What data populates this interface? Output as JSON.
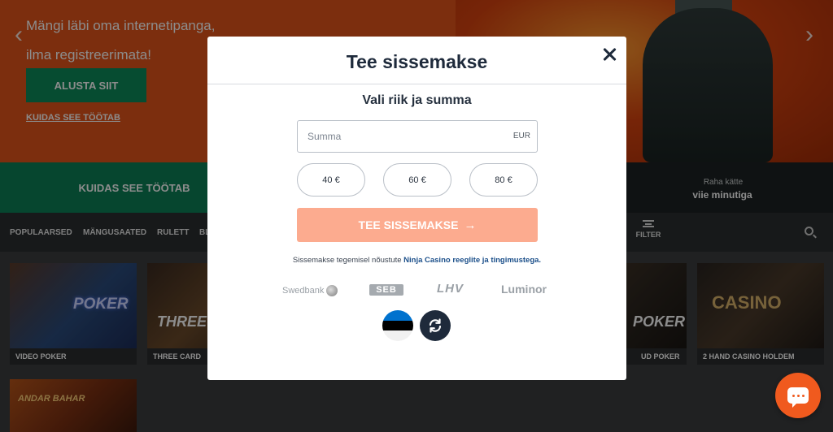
{
  "hero": {
    "text_line1": "Mängi läbi oma internetipanga,",
    "text_line2": "ilma registreerimata!",
    "cta_label": "ALUSTA SIIT",
    "how_link": "KUIDAS SEE TÖÖTAB"
  },
  "band": {
    "green_label": "KUIDAS SEE TÖÖTAB",
    "small_label": "Raha kätte",
    "big_label": "viie minutiga"
  },
  "nav": {
    "items": [
      "POPULAARSED",
      "MÄNGUSAATED",
      "RULETT",
      "BL"
    ],
    "filter_label": "FILTER"
  },
  "tiles": [
    {
      "caption": "VIDEO POKER"
    },
    {
      "caption": "THREE CARD"
    },
    {
      "caption": "UD POKER"
    },
    {
      "caption": "2 HAND CASINO HOLDEM"
    },
    {
      "caption": ""
    }
  ],
  "modal": {
    "title": "Tee sissemakse",
    "subtitle": "Vali riik ja summa",
    "amount_placeholder": "Summa",
    "currency": "EUR",
    "presets": [
      "40 €",
      "60 €",
      "80 €"
    ],
    "deposit_label": "TEE SISSEMAKSE",
    "terms_prefix": "Sissemakse tegemisel nõustute",
    "terms_link": "Ninja Casino reeglite ja tingimustega.",
    "banks": [
      "Swedbank",
      "SEB",
      "LHV",
      "Luminor"
    ]
  },
  "colors": {
    "accent_orange": "#f05a1e",
    "deposit_button": "#fcab8f",
    "navy": "#1e2a3b",
    "link_blue": "#1b4f8a"
  }
}
